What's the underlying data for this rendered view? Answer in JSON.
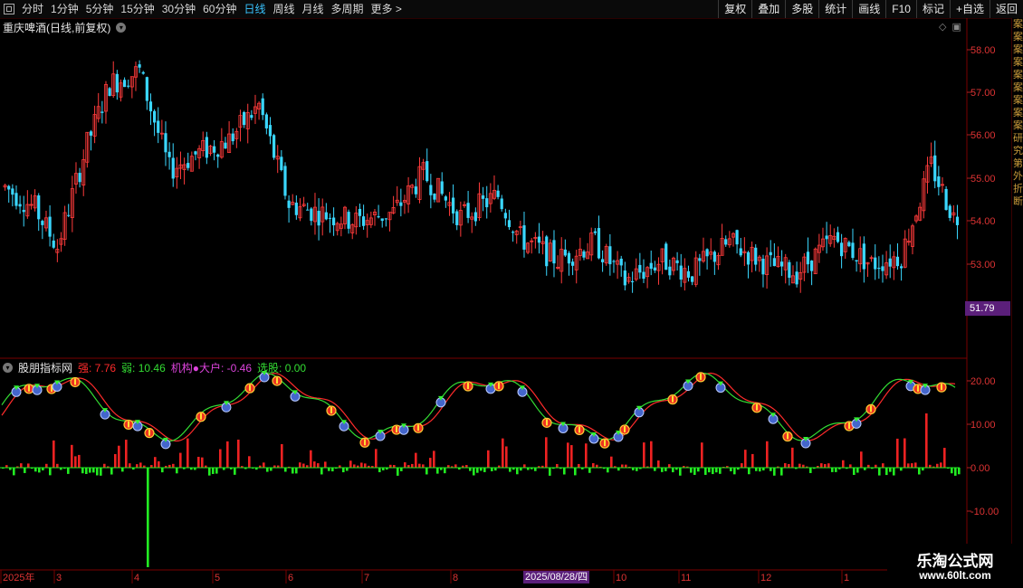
{
  "toolbar": {
    "periods": [
      "分时",
      "1分钟",
      "5分钟",
      "15分钟",
      "30分钟",
      "60分钟",
      "日线",
      "周线",
      "月线",
      "多周期",
      "更多 >"
    ],
    "active_period": "日线",
    "right_buttons": [
      "复权",
      "叠加",
      "多股",
      "统计",
      "画线",
      "F10",
      "标记",
      "+自选",
      "返回"
    ]
  },
  "main_chart": {
    "title": "重庆啤酒(日线,前复权)",
    "price_labels": [
      "58.00",
      "57.00",
      "56.00",
      "55.00",
      "54.00",
      "53.00"
    ],
    "current_price": "51.79",
    "colors": {
      "up": "#ff3b3b",
      "down": "#3ad7ff",
      "grid": "#3a0000"
    }
  },
  "indicator": {
    "name": "股朋指标网",
    "strong_label": "强: 7.76",
    "weak_label": "弱: 10.46",
    "inst_label": "机构●大户: -0.46",
    "select_label": "选股: 0.00",
    "axis_labels": [
      "20.00",
      "10.00",
      "0.00",
      "-10.00"
    ],
    "colors": {
      "strong": "#ff2b2b",
      "weak": "#33dd33",
      "inst": "#dd44dd",
      "select": "#33dd33"
    }
  },
  "x_axis": {
    "labels": [
      "2025年",
      "3",
      "4",
      "5",
      "6",
      "7",
      "8",
      "10",
      "11",
      "12",
      "1"
    ],
    "cursor_date": "2025/08/28/四"
  },
  "side_strip": {
    "chars": [
      "案",
      "案",
      "案",
      "案",
      "案",
      "案",
      "案",
      "案",
      "案",
      "研",
      "究",
      "第",
      "外",
      "折",
      "断"
    ]
  },
  "watermark": {
    "title": "乐淘公式网",
    "url": "www.60lt.com"
  }
}
